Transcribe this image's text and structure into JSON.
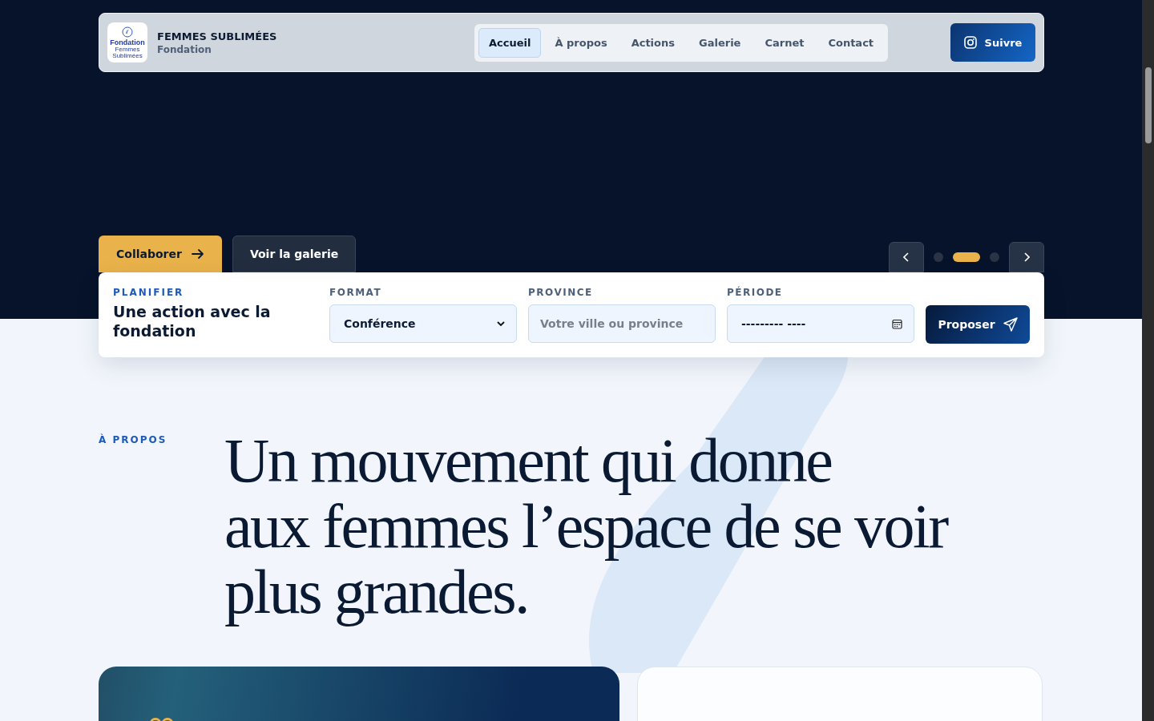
{
  "header": {
    "logo": {
      "word": "Fondation",
      "small": "Femmes Sublimées"
    },
    "brand": "FEMMES SUBLIMÉES",
    "subtitle": "Fondation",
    "nav": [
      {
        "label": "Accueil",
        "selected": true
      },
      {
        "label": "À propos",
        "selected": false
      },
      {
        "label": "Actions",
        "selected": false
      },
      {
        "label": "Galerie",
        "selected": false
      },
      {
        "label": "Carnet",
        "selected": false
      },
      {
        "label": "Contact",
        "selected": false
      }
    ],
    "follow_button": "Suivre"
  },
  "hero": {
    "buttons": [
      {
        "label": "Collaborer",
        "kind": "primary"
      },
      {
        "label": "Voir la galerie",
        "kind": "secondary"
      }
    ],
    "carousel": [
      {
        "selected": false
      },
      {
        "selected": true
      },
      {
        "selected": false
      }
    ]
  },
  "planner": {
    "eyebrow": "PLANIFIER",
    "title": "Une action avec la fondation",
    "format": {
      "label": "FORMAT",
      "value": "Conférence"
    },
    "province": {
      "label": "PROVINCE",
      "placeholder": "Votre ville ou province"
    },
    "period": {
      "label": "PÉRIODE",
      "placeholder": "--------- ----"
    },
    "submit": "Proposer"
  },
  "about": {
    "eyebrow": "À PROPOS",
    "heading": [
      "Un mouvement qui donne",
      "aux femmes l’espace de se voir",
      "plus grandes."
    ]
  }
}
